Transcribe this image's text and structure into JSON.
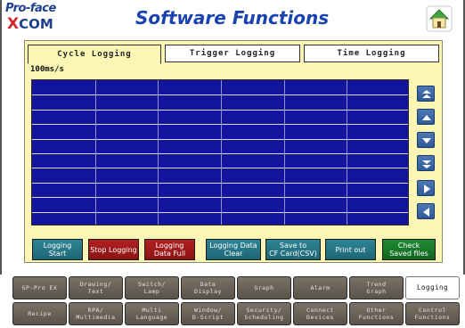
{
  "header": {
    "logo_top": "Pro-face",
    "logo_x": "X",
    "logo_bottom": "COM",
    "title": "Software Functions",
    "home_icon": "home-icon"
  },
  "tabs": [
    {
      "label": "Cycle Logging",
      "active": true
    },
    {
      "label": "Trigger Logging",
      "active": false
    },
    {
      "label": "Time Logging",
      "active": false
    }
  ],
  "graph": {
    "unit_label": "100ms/s",
    "background_color": "#13149c"
  },
  "scroll_buttons": [
    "scroll-top-icon",
    "scroll-up-icon",
    "scroll-down-icon",
    "scroll-bottom-icon",
    "scroll-right-icon",
    "scroll-left-icon"
  ],
  "actions": [
    {
      "label": "Logging\nStart",
      "color": "teal"
    },
    {
      "label": "Stop Logging",
      "color": "red"
    },
    {
      "label": "Logging\nData Full",
      "color": "red"
    },
    {
      "label": "Logging Data\nClear",
      "color": "teal"
    },
    {
      "label": "Save to\nCF Card(CSV)",
      "color": "teal"
    },
    {
      "label": "Print out",
      "color": "teal"
    },
    {
      "label": "Check\nSaved files",
      "color": "green"
    }
  ],
  "nav_row1": [
    {
      "label": "GP-Pro EX",
      "active": false
    },
    {
      "label": "Drawing/\nText",
      "active": false
    },
    {
      "label": "Switch/\nLamp",
      "active": false
    },
    {
      "label": "Data\nDisplay",
      "active": false
    },
    {
      "label": "Graph",
      "active": false
    },
    {
      "label": "Alarm",
      "active": false
    },
    {
      "label": "Trend\nGraph",
      "active": false
    },
    {
      "label": "Logging",
      "active": true
    }
  ],
  "nav_row2": [
    {
      "label": "Recipe",
      "active": false
    },
    {
      "label": "RPA/\nMultimedia",
      "active": false
    },
    {
      "label": "Multi\nLanguage",
      "active": false
    },
    {
      "label": "Window/\nD-Script",
      "active": false
    },
    {
      "label": "Security/\nScheduling",
      "active": false
    },
    {
      "label": "Connect\nDevices",
      "active": false
    },
    {
      "label": "Other\nFunctions",
      "active": false
    },
    {
      "label": "Control\nFunctions",
      "active": false
    }
  ]
}
